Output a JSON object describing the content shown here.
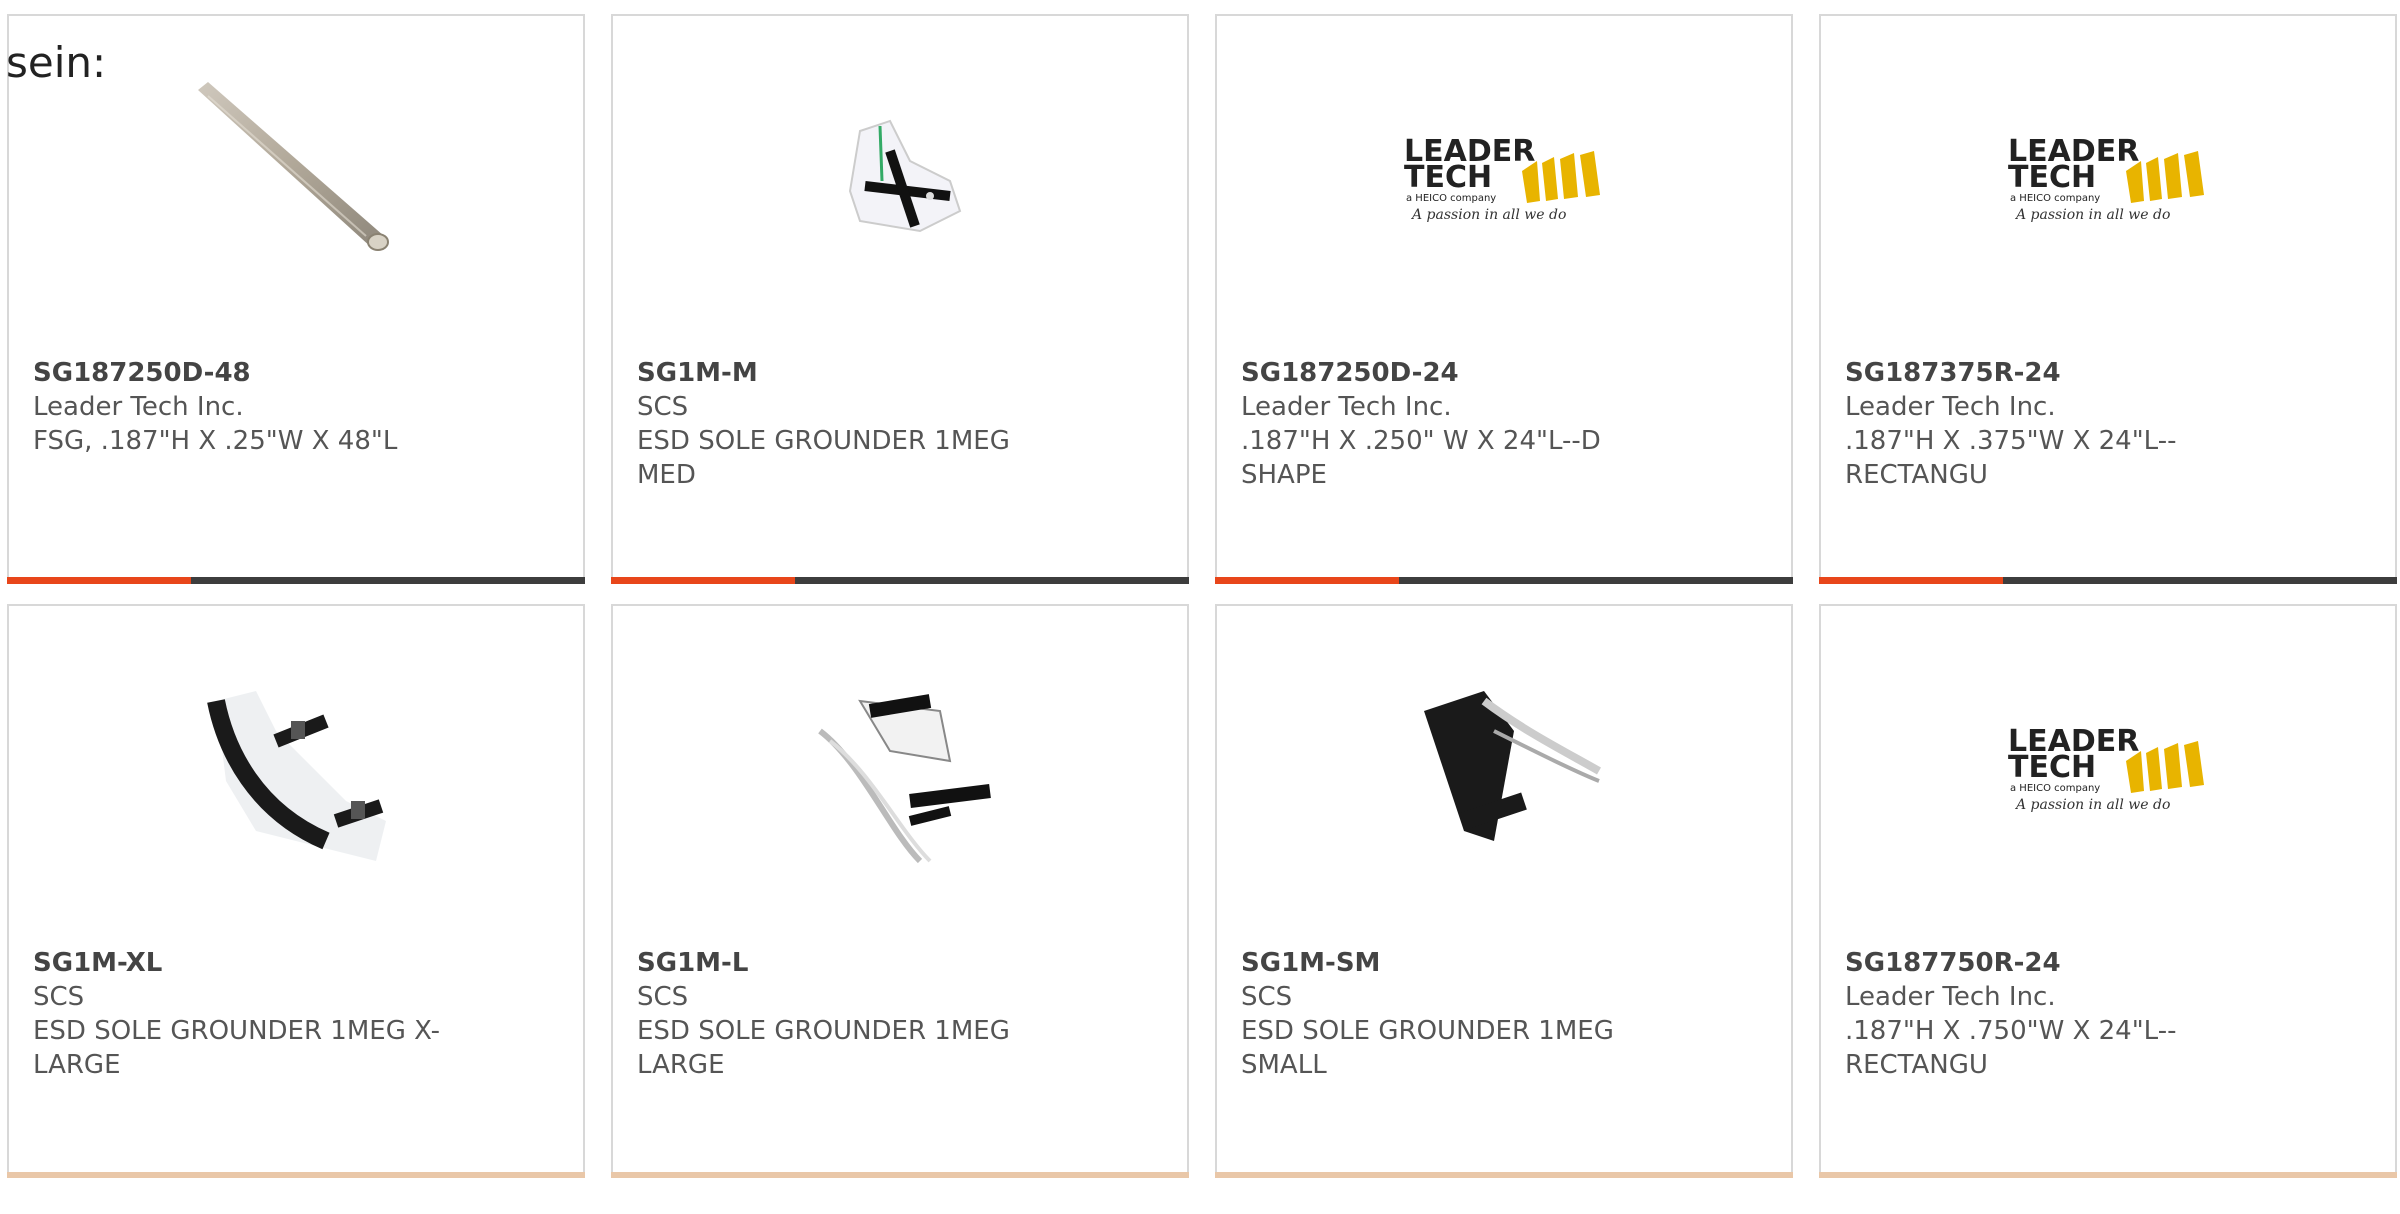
{
  "lead_text": "sein:",
  "colors": {
    "accent": "#e8461a",
    "bar": "#3d3d3d",
    "border": "#d8d8d8",
    "logo_yellow": "#e8b400"
  },
  "products": [
    {
      "part_number": "SG187250D-48",
      "manufacturer": "Leader Tech Inc.",
      "description": "FSG, .187\"H X .25\"W X 48\"L",
      "image": "gasket-rod-image"
    },
    {
      "part_number": "SG1M-M",
      "manufacturer": "SCS",
      "description": "ESD SOLE GROUNDER 1MEG MED",
      "image": "sole-grounder-on-foot-image"
    },
    {
      "part_number": "SG187250D-24",
      "manufacturer": "Leader Tech Inc.",
      "description": ".187\"H X .250\" W X 24\"L--D SHAPE",
      "image": "leader-tech-logo"
    },
    {
      "part_number": "SG187375R-24",
      "manufacturer": "Leader Tech Inc.",
      "description": ".187\"H X .375\"W X 24\"L--RECTANGU",
      "image": "leader-tech-logo"
    },
    {
      "part_number": "SG1M-XL",
      "manufacturer": "SCS",
      "description": "ESD SOLE GROUNDER 1MEG X-LARGE",
      "image": "sole-grounder-image"
    },
    {
      "part_number": "SG1M-L",
      "manufacturer": "SCS",
      "description": "ESD SOLE GROUNDER 1MEG LARGE",
      "image": "sole-grounder-strap-image"
    },
    {
      "part_number": "SG1M-SM",
      "manufacturer": "SCS",
      "description": "ESD SOLE GROUNDER 1MEG SMALL",
      "image": "sole-grounder-black-image"
    },
    {
      "part_number": "SG187750R-24",
      "manufacturer": "Leader Tech Inc.",
      "description": ".187\"H X .750\"W X 24\"L--RECTANGU",
      "image": "leader-tech-logo"
    }
  ],
  "logo": {
    "line1": "LEADER",
    "line2": "TECH",
    "tagline": "a HEICO company",
    "slogan": "A passion in all we do"
  }
}
